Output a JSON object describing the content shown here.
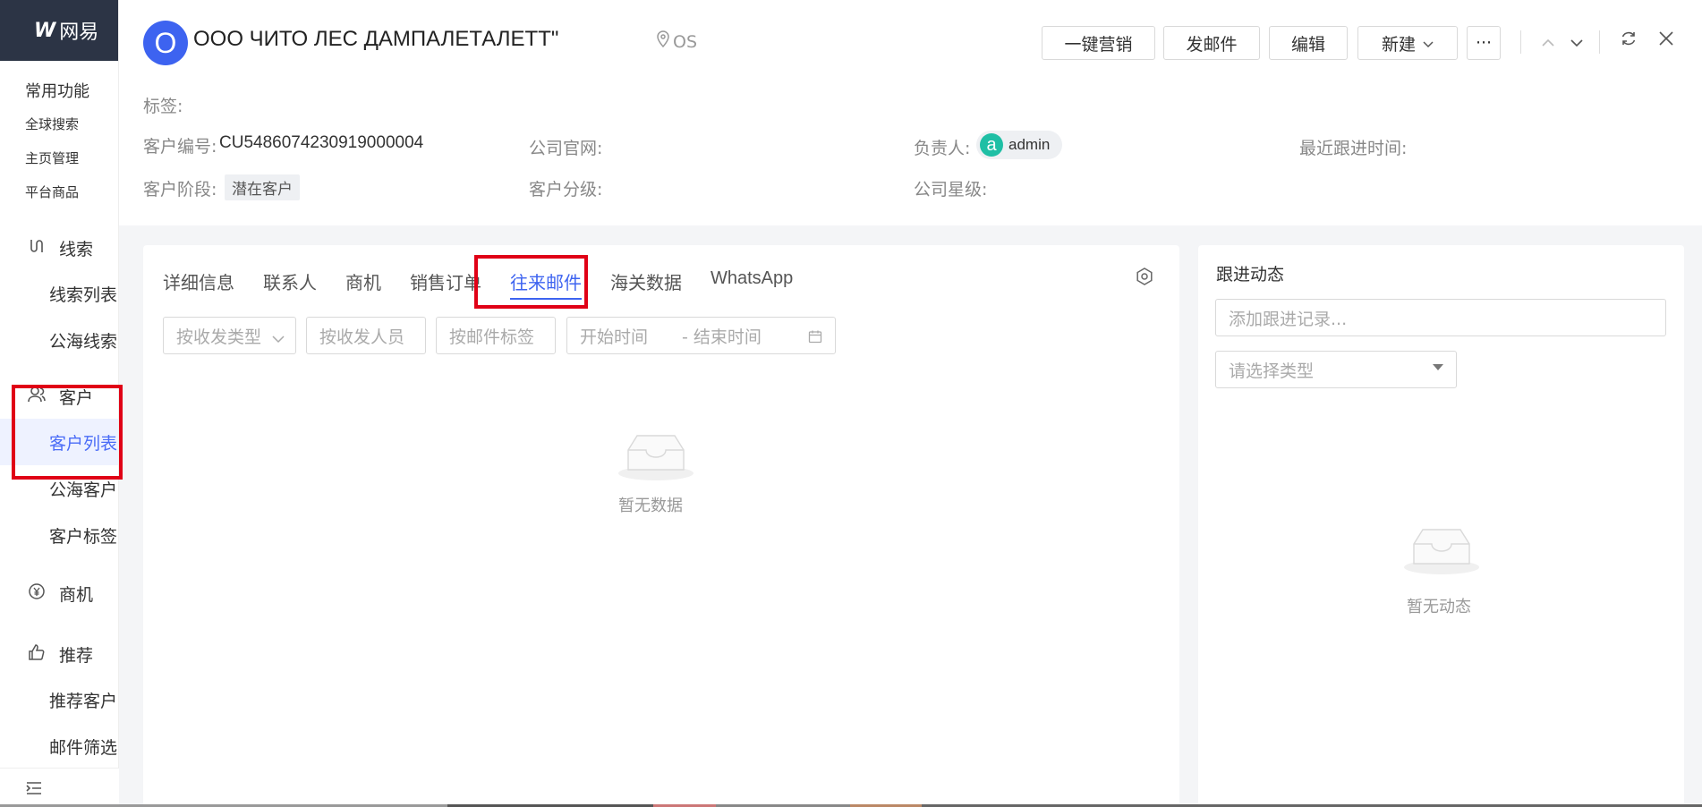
{
  "sidebar": {
    "brand_text": "网易",
    "common_title": "常用功能",
    "common_items": [
      "全球搜索",
      "主页管理",
      "平台商品"
    ],
    "groups": [
      {
        "label": "线索",
        "icon": "route-icon",
        "subs": [
          "线索列表",
          "公海线索"
        ]
      },
      {
        "label": "客户",
        "icon": "users-icon",
        "subs": [
          "客户列表",
          "公海客户",
          "客户标签"
        ]
      },
      {
        "label": "商机",
        "icon": "yen-icon",
        "subs": []
      },
      {
        "label": "推荐",
        "icon": "thumbs-up-icon",
        "subs": [
          "推荐客户",
          "邮件筛选"
        ]
      }
    ]
  },
  "header": {
    "avatar_letter": "O",
    "title": "ООО ЧИТО ЛЕС ДАМПАЛЕТАЛЕТТ\"",
    "location": "OS",
    "buttons": {
      "marketing": "一键营销",
      "send_mail": "发邮件",
      "edit": "编辑",
      "new": "新建",
      "more": "···"
    },
    "fields": {
      "tags_label": "标签:",
      "customer_no_label": "客户编号:",
      "customer_no_value": "CU5486074230919000004",
      "website_label": "公司官网:",
      "owner_label": "负责人:",
      "owner_avatar": "a",
      "owner_value": "admin",
      "last_follow_label": "最近跟进时间:",
      "stage_label": "客户阶段:",
      "stage_value": "潜在客户",
      "grade_label": "客户分级:",
      "star_label": "公司星级:"
    }
  },
  "main": {
    "tabs": [
      "详细信息",
      "联系人",
      "商机",
      "销售订单",
      "往来邮件",
      "海关数据",
      "WhatsApp"
    ],
    "active_tab": "往来邮件",
    "filters": {
      "type": "按收发类型",
      "person": "按收发人员",
      "mail_tag": "按邮件标签",
      "start_time": "开始时间",
      "end_time": "- 结束时间"
    },
    "empty_text": "暂无数据"
  },
  "right": {
    "title": "跟进动态",
    "input_placeholder": "添加跟进记录...",
    "type_placeholder": "请选择类型",
    "empty_text": "暂无动态"
  }
}
